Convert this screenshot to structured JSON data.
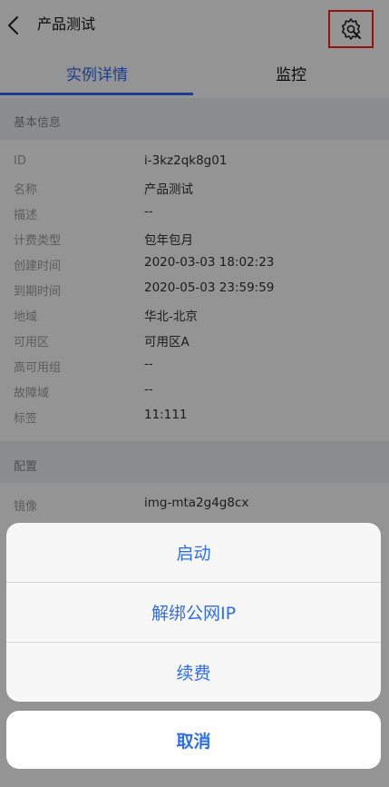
{
  "header": {
    "title": "产品测试",
    "icons": {
      "back": "chevron-left-icon",
      "settings": "gear-wrench-icon"
    },
    "highlight_color": "#ff1e1e"
  },
  "tabs": [
    {
      "label": "实例详情",
      "active": true
    },
    {
      "label": "监控",
      "active": false
    }
  ],
  "sections": {
    "basic": {
      "title": "基本信息",
      "rows": [
        {
          "label": "ID",
          "value": "i-3kz2qk8g01"
        },
        {
          "label": "名称",
          "value": "产品测试"
        },
        {
          "label": "描述",
          "value": "--"
        },
        {
          "label": "计费类型",
          "value": "包年包月"
        },
        {
          "label": "创建时间",
          "value": "2020-03-03 18:02:23"
        },
        {
          "label": "到期时间",
          "value": "2020-05-03 23:59:59"
        },
        {
          "label": "地域",
          "value": "华北-北京"
        },
        {
          "label": "可用区",
          "value": "可用区A"
        },
        {
          "label": "高可用组",
          "value": "--"
        },
        {
          "label": "故障域",
          "value": "--"
        },
        {
          "label": "标签",
          "value": "11:111"
        }
      ]
    },
    "config": {
      "title": "配置",
      "rows": [
        {
          "label": "镜像",
          "value": "img-mta2g4g8cx"
        }
      ]
    }
  },
  "action_sheet": {
    "items": [
      "启动",
      "解绑公网IP",
      "续费"
    ],
    "cancel": "取消"
  },
  "colors": {
    "accent": "#2f6df0",
    "section_bg": "#f2f3f5",
    "overlay": "rgba(0,0,0,0.42)"
  }
}
